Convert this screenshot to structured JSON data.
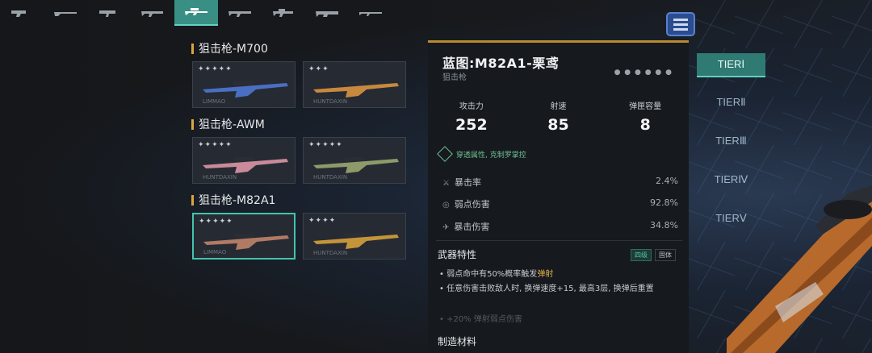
{
  "weapon_tabs": [
    {
      "icon": "pistol-icon",
      "active": false
    },
    {
      "icon": "shotgun-icon",
      "active": false
    },
    {
      "icon": "smg-icon",
      "active": false
    },
    {
      "icon": "assault-rifle-icon",
      "active": false
    },
    {
      "icon": "sniper-rifle-icon",
      "active": true
    },
    {
      "icon": "rifle-icon",
      "active": false
    },
    {
      "icon": "carbine-icon",
      "active": false
    },
    {
      "icon": "lmg-icon",
      "active": false
    },
    {
      "icon": "dmr-icon",
      "active": false
    }
  ],
  "groups": [
    {
      "title": "狙击枪-M700",
      "cards": [
        {
          "stars": "✦✦✦✦✦",
          "maker": "LIMMAO",
          "selected": false,
          "color": "#4a6fc2"
        },
        {
          "stars": "✦✦✦",
          "maker": "HUNTDAXIN",
          "selected": false,
          "color": "#c8883e"
        }
      ]
    },
    {
      "title": "狙击枪-AWM",
      "cards": [
        {
          "stars": "✦✦✦✦✦",
          "maker": "HUNTDAXIN",
          "selected": false,
          "color": "#c98a9a"
        },
        {
          "stars": "✦✦✦✦✦",
          "maker": "HUNTDAXIN",
          "selected": false,
          "color": "#8e9a6a"
        }
      ]
    },
    {
      "title": "狙击枪-M82A1",
      "cards": [
        {
          "stars": "✦✦✦✦✦",
          "maker": "LIMMAO",
          "selected": true,
          "color": "#b07a64"
        },
        {
          "stars": "✦✦✦✦",
          "maker": "HUNTDAXIN",
          "selected": false,
          "color": "#c4943a"
        }
      ]
    }
  ],
  "detail": {
    "title": "蓝图:M82A1-栗鸢",
    "subtitle": "狙击枪",
    "rarity_dots": "● ● ● ● ● ●",
    "stats": [
      {
        "label": "攻击力",
        "value": "252"
      },
      {
        "label": "射速",
        "value": "85"
      },
      {
        "label": "弹匣容量",
        "value": "8"
      }
    ],
    "penetration": "穿透属性, 克制罗掌控",
    "rows": [
      {
        "icon": "crit-rate-icon",
        "glyph": "⚔",
        "label": "暴击率",
        "value": "2.4%"
      },
      {
        "icon": "weakpoint-icon",
        "glyph": "◎",
        "label": "弱点伤害",
        "value": "92.8%"
      },
      {
        "icon": "crit-damage-icon",
        "glyph": "✈",
        "label": "暴击伤害",
        "value": "34.8%"
      }
    ],
    "traits_title": "武器特性",
    "tag_a": "四级",
    "tag_b": "固体",
    "trait1_pre": "弱点命中有50%概率触发",
    "trait1_hl": "弹射",
    "trait2": "任意伤害击败敌人时, 换弹速度+15, 最高3层, 换弹后重置",
    "trait3": "+20% 弹射弱点伤害",
    "craft_title": "制造材料"
  },
  "tiers": [
    "TIERⅠ",
    "TIERⅡ",
    "TIERⅢ",
    "TIERⅣ",
    "TIERⅤ"
  ],
  "active_tier": 0
}
